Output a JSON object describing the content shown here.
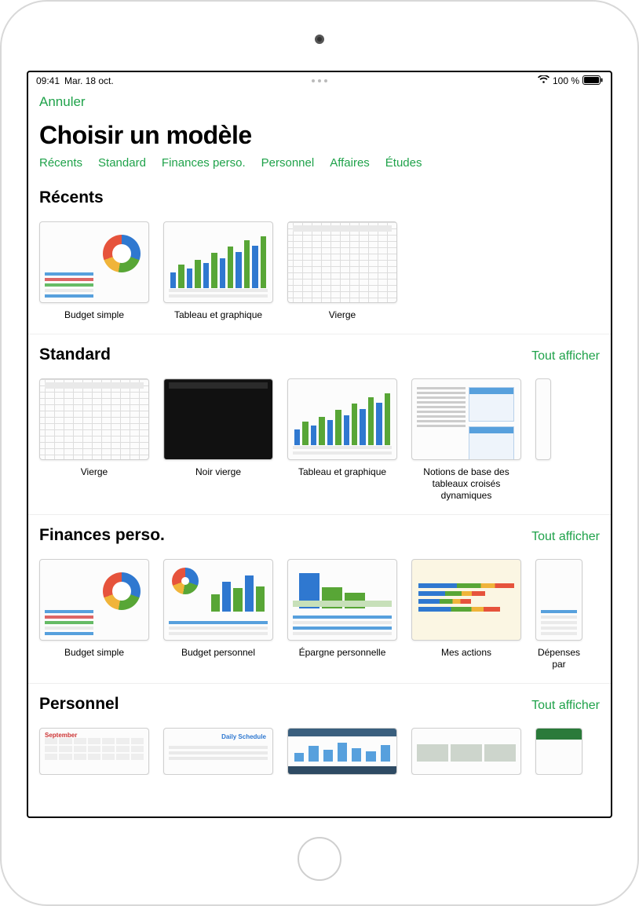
{
  "status": {
    "time": "09:41",
    "date": "Mar. 18 oct.",
    "battery": "100 %"
  },
  "nav": {
    "cancel": "Annuler"
  },
  "title": "Choisir un modèle",
  "tabs": [
    "Récents",
    "Standard",
    "Finances perso.",
    "Personnel",
    "Affaires",
    "Études"
  ],
  "see_all_label": "Tout afficher",
  "sections": {
    "recents": {
      "title": "Récents",
      "see_all": false,
      "items": [
        {
          "label": "Budget simple",
          "kind": "budget-simple"
        },
        {
          "label": "Tableau et graphique",
          "kind": "chart-table"
        },
        {
          "label": "Vierge",
          "kind": "blank"
        }
      ]
    },
    "standard": {
      "title": "Standard",
      "see_all": true,
      "items": [
        {
          "label": "Vierge",
          "kind": "blank"
        },
        {
          "label": "Noir vierge",
          "kind": "blank-dark"
        },
        {
          "label": "Tableau et graphique",
          "kind": "chart-table"
        },
        {
          "label": "Notions de base des tableaux croisés dynamiques",
          "kind": "pivot-basics"
        },
        {
          "label": "",
          "kind": "partial"
        }
      ]
    },
    "finances": {
      "title": "Finances perso.",
      "see_all": true,
      "items": [
        {
          "label": "Budget simple",
          "kind": "budget-simple"
        },
        {
          "label": "Budget personnel",
          "kind": "budget-personal"
        },
        {
          "label": "Épargne personnelle",
          "kind": "savings"
        },
        {
          "label": "Mes actions",
          "kind": "stocks"
        },
        {
          "label": "Dépenses par",
          "kind": "expenses-partial"
        }
      ]
    },
    "personnel": {
      "title": "Personnel",
      "see_all": true,
      "items": [
        {
          "label": "",
          "kind": "calendar"
        },
        {
          "label": "",
          "kind": "daily-schedule"
        },
        {
          "label": "",
          "kind": "running-log"
        },
        {
          "label": "",
          "kind": "remodel"
        },
        {
          "label": "",
          "kind": "soccer-team"
        }
      ]
    }
  }
}
